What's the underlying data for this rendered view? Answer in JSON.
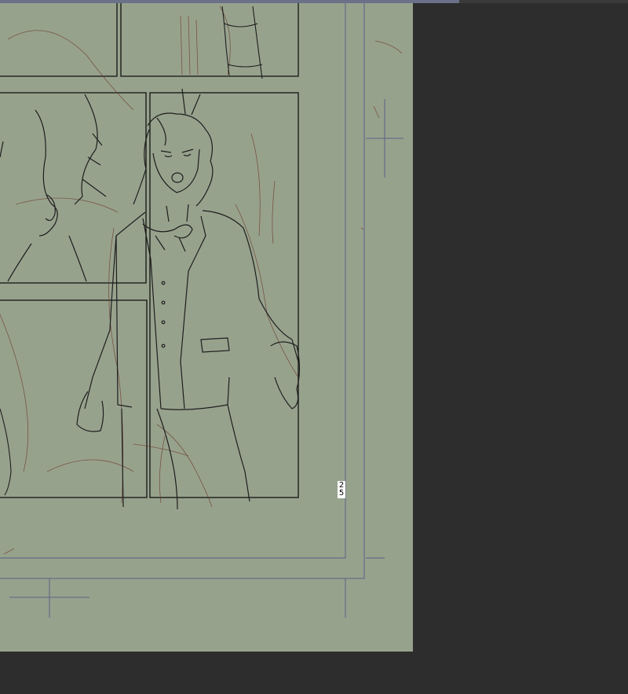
{
  "app": {
    "colors": {
      "workspace_bg": "#2d2d2d",
      "canvas_paper": "#97a28d",
      "guide_lines": "#5a6386",
      "panel_border": "#111111",
      "sketch_red": "#6b3a2a",
      "sketch_ink": "#1e1e1e"
    }
  },
  "canvas": {
    "page_number_digits": [
      "2",
      "5"
    ]
  }
}
